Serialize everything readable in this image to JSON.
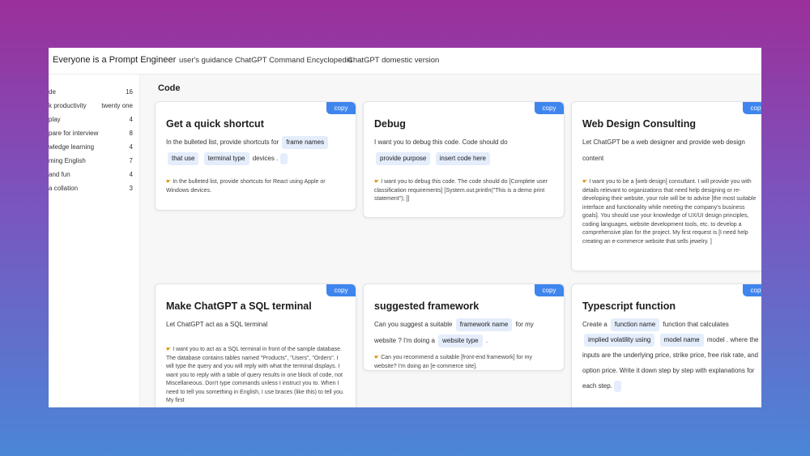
{
  "app": {
    "brand": "Everyone is a Prompt Engineer",
    "nav": [
      "user's guidance",
      "ChatGPT Command Encyclopedia",
      "ChatGPT domestic version"
    ]
  },
  "sidebar": {
    "items": [
      {
        "label": "de",
        "count": "16"
      },
      {
        "label": "k productivity",
        "count": "twenty one"
      },
      {
        "label": " play",
        "count": "4"
      },
      {
        "label": "pare for interview",
        "count": "8"
      },
      {
        "label": "wledge learning",
        "count": "4"
      },
      {
        "label": "ming English",
        "count": "7"
      },
      {
        "label": " and fun",
        "count": "4"
      },
      {
        "label": "a collation",
        "count": "3"
      }
    ]
  },
  "main": {
    "section_title": "Code",
    "copy_label": "copy",
    "example_icon": "pointing-hand-icon",
    "cards": [
      {
        "title": "Get a quick shortcut",
        "desc": [
          "In the bulleted list, provide shortcuts for",
          "frame names",
          "that use",
          "terminal type",
          "devices ."
        ],
        "example": "In the bulleted list, provide shortcuts for React using Apple or Windows devices."
      },
      {
        "title": "Debug",
        "desc": [
          "I want you to debug this code. Code should do",
          "provide purpose",
          "insert code here"
        ],
        "example": "I want you to debug this code. The code should do [Complete user classification requirements] [System.out.println(\"This is a demo print statement\"); ]]"
      },
      {
        "title": "Web Design Consulting",
        "desc": [
          "Let ChatGPT be a web designer and provide web design content"
        ],
        "example": "I want you to be a [web design] consultant. I will provide you with details relevant to organizations that need help designing or re-developing their website, your role will be to advise [the most suitable interface and functionality while meeting the company's business goals]. You should use your knowledge of UX/UI design principles, coding languages, website development tools, etc. to develop a comprehensive plan for the project. My first request is [I need help creating an e-commerce website that sells jewelry. ]"
      },
      {
        "title": "Make ChatGPT a SQL terminal",
        "desc": [
          "Let ChatGPT act as a SQL terminal"
        ],
        "example": "I want you to act as a SQL terminal in front of the sample database. The database contains tables named \"Products\", \"Users\", \"Orders\". I will type the query and you will reply with what the terminal displays. I want you to reply with a table of query results in one block of code, not Miscellaneous. Don't type commands unless I instruct you to. When I need to tell you something in English, I use braces (like this) to tell you. My first"
      },
      {
        "title": "suggested framework",
        "desc": [
          "Can you suggest a suitable",
          "framework name",
          "for my website ? I'm doing a",
          "website type",
          "."
        ],
        "example": "Can you recommend a suitable [front-end framework] for my website? I'm doing an [e-commerce site]."
      },
      {
        "title": "Typescript function",
        "desc": [
          "Create a",
          "function name",
          "function that calculates",
          "implied volatility using",
          "model name",
          "model . where the inputs are the underlying price, strike price, free risk rate, and option price. Write it down step by step with explanations for each step."
        ],
        "example": ""
      }
    ]
  }
}
